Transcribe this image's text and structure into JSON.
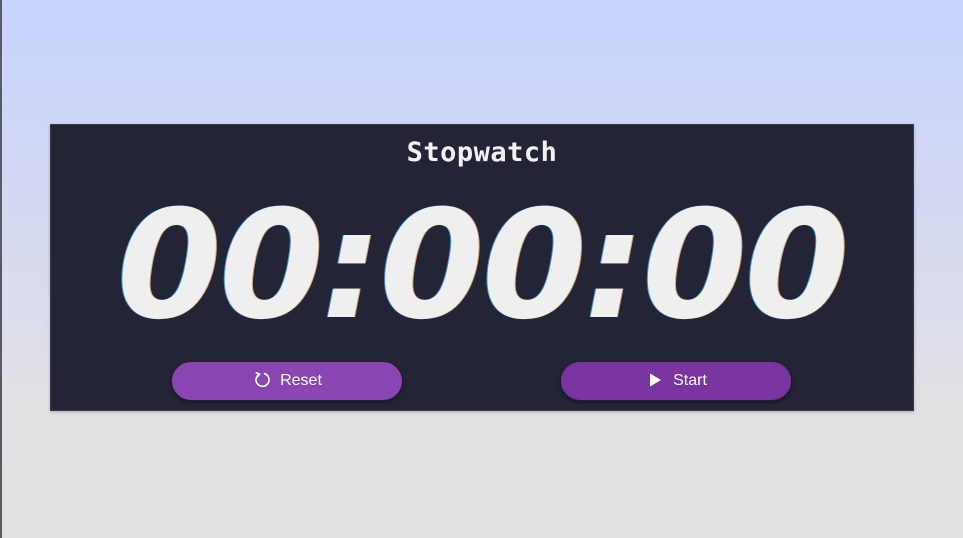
{
  "stopwatch": {
    "title": "Stopwatch",
    "time": "00:00:00"
  },
  "controls": {
    "reset_label": "Reset",
    "reset_icon": "reset-icon",
    "start_label": "Start",
    "start_icon": "play-icon"
  },
  "colors": {
    "panel": "#232536",
    "reset_button": "#8a46b0",
    "start_button": "#7a34a0",
    "text": "#efefef"
  }
}
